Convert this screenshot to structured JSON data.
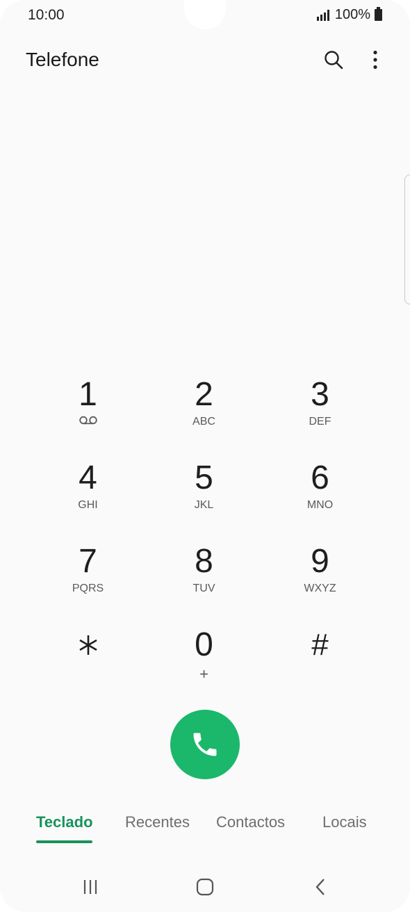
{
  "status_bar": {
    "time": "10:00",
    "battery": "100%"
  },
  "header": {
    "title": "Telefone",
    "icons": [
      "search-icon",
      "more-options-icon"
    ]
  },
  "keypad": {
    "keys": [
      {
        "digit": "1",
        "letters": "",
        "icon": "voicemail-icon"
      },
      {
        "digit": "2",
        "letters": "ABC"
      },
      {
        "digit": "3",
        "letters": "DEF"
      },
      {
        "digit": "4",
        "letters": "GHI"
      },
      {
        "digit": "5",
        "letters": "JKL"
      },
      {
        "digit": "6",
        "letters": "MNO"
      },
      {
        "digit": "7",
        "letters": "PQRS"
      },
      {
        "digit": "8",
        "letters": "TUV"
      },
      {
        "digit": "9",
        "letters": "WXYZ"
      },
      {
        "digit": "*",
        "letters": ""
      },
      {
        "digit": "0",
        "letters": "+"
      },
      {
        "digit": "#",
        "letters": ""
      }
    ]
  },
  "call_button": {
    "icon": "phone-icon",
    "color": "#1bb76b"
  },
  "tabs": [
    {
      "label": "Teclado",
      "active": true
    },
    {
      "label": "Recentes",
      "active": false
    },
    {
      "label": "Contactos",
      "active": false
    },
    {
      "label": "Locais",
      "active": false
    }
  ],
  "accent_color": "#17935a",
  "nav_bar": {
    "icons": [
      "recent-apps-icon",
      "home-icon",
      "back-icon"
    ]
  }
}
